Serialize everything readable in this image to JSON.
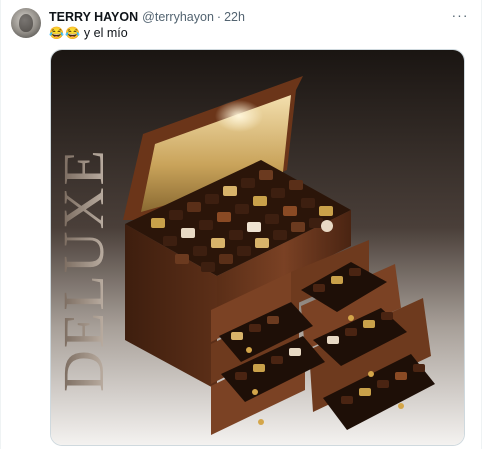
{
  "tweet": {
    "author_name": "TERRY HAYON",
    "handle": "@terryhayon",
    "separator": "·",
    "time": "22h",
    "more_label": "···",
    "emoji_1": "😂",
    "emoji_2": "😂",
    "text": "y el mío"
  },
  "media": {
    "overlay_text": "DELUXE",
    "icon": "chocolate-box-photo"
  },
  "colors": {
    "text_primary": "#0f1419",
    "text_secondary": "#536471",
    "border": "#cfd9de"
  }
}
